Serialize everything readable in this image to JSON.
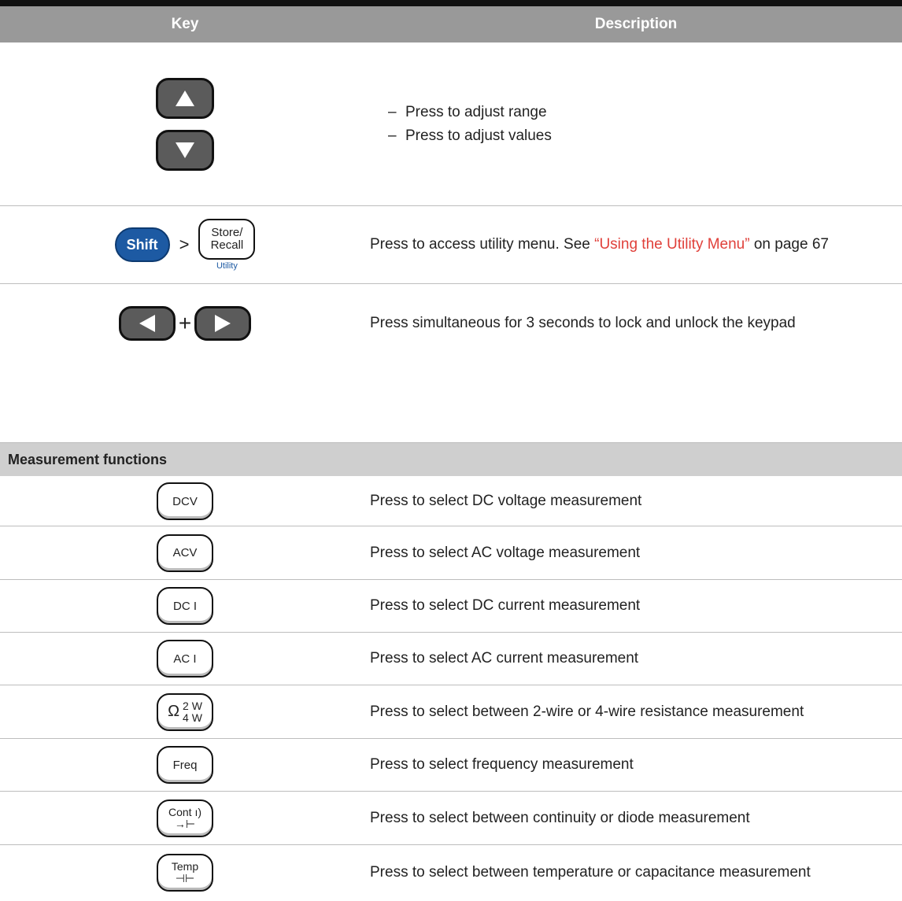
{
  "header": {
    "key": "Key",
    "description": "Description"
  },
  "rows": {
    "updown": {
      "desc1": "Press to adjust range",
      "desc2": "Press to adjust values"
    },
    "utility": {
      "shift_label": "Shift",
      "store_line1": "Store/",
      "store_line2": "Recall",
      "utility_label": "Utility",
      "desc_prefix": "Press to access utility menu. See ",
      "link_text": "“Using the Utility Menu”",
      "desc_suffix": " on page 67"
    },
    "lock": {
      "plus": "+",
      "desc": "Press simultaneous for 3 seconds to lock and unlock the keypad"
    }
  },
  "section_title": "Measurement functions",
  "functions": [
    {
      "key": "DCV",
      "desc": "Press to select DC voltage measurement"
    },
    {
      "key": "ACV",
      "desc": "Press to select AC voltage measurement"
    },
    {
      "key": "DC I",
      "desc": "Press to select DC current measurement"
    },
    {
      "key": "AC I",
      "desc": "Press to select AC current measurement"
    },
    {
      "key_symbol": "Ω",
      "key_top": "2 W",
      "key_bottom": "4 W",
      "desc": "Press to select between 2-wire or 4-wire resistance measurement"
    },
    {
      "key": "Freq",
      "desc": "Press to select frequency measurement"
    },
    {
      "key_top": "Cont ı)",
      "key_bottom": "→⊢",
      "desc": "Press to select between continuity or diode measurement"
    },
    {
      "key_top": "Temp",
      "key_bottom": "⊣⊢",
      "desc": "Press to select between temperature or capacitance measurement"
    }
  ]
}
